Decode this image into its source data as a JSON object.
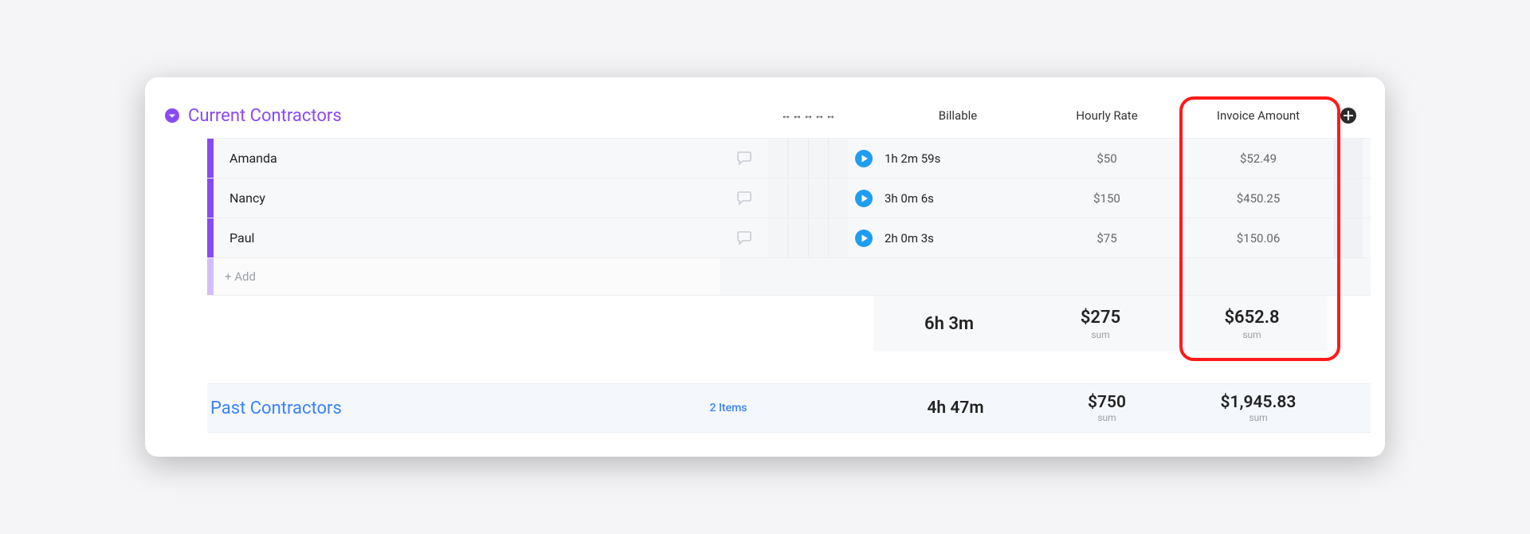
{
  "section": {
    "title": "Current Contractors",
    "columns": {
      "billable": "Billable",
      "hourly_rate": "Hourly Rate",
      "invoice_amount": "Invoice Amount"
    },
    "resize_glyph": "↔",
    "rows": [
      {
        "name": "Amanda",
        "billable": "1h 2m 59s",
        "rate": "$50",
        "invoice": "$52.49"
      },
      {
        "name": "Nancy",
        "billable": "3h 0m 6s",
        "rate": "$150",
        "invoice": "$450.25"
      },
      {
        "name": "Paul",
        "billable": "2h 0m 3s",
        "rate": "$75",
        "invoice": "$150.06"
      }
    ],
    "add_row_label": "+ Add",
    "sum": {
      "billable": "6h 3m",
      "rate": "$275",
      "invoice": "$652.8",
      "label": "sum"
    }
  },
  "past": {
    "title": "Past Contractors",
    "count_label": "2 Items",
    "billable": "4h 47m",
    "rate": "$750",
    "invoice": "$1,945.83",
    "sum_label": "sum"
  },
  "colors": {
    "accent_purple": "#8a4af3",
    "accent_blue": "#3b82f6",
    "highlight_red": "#ff1a1a"
  }
}
